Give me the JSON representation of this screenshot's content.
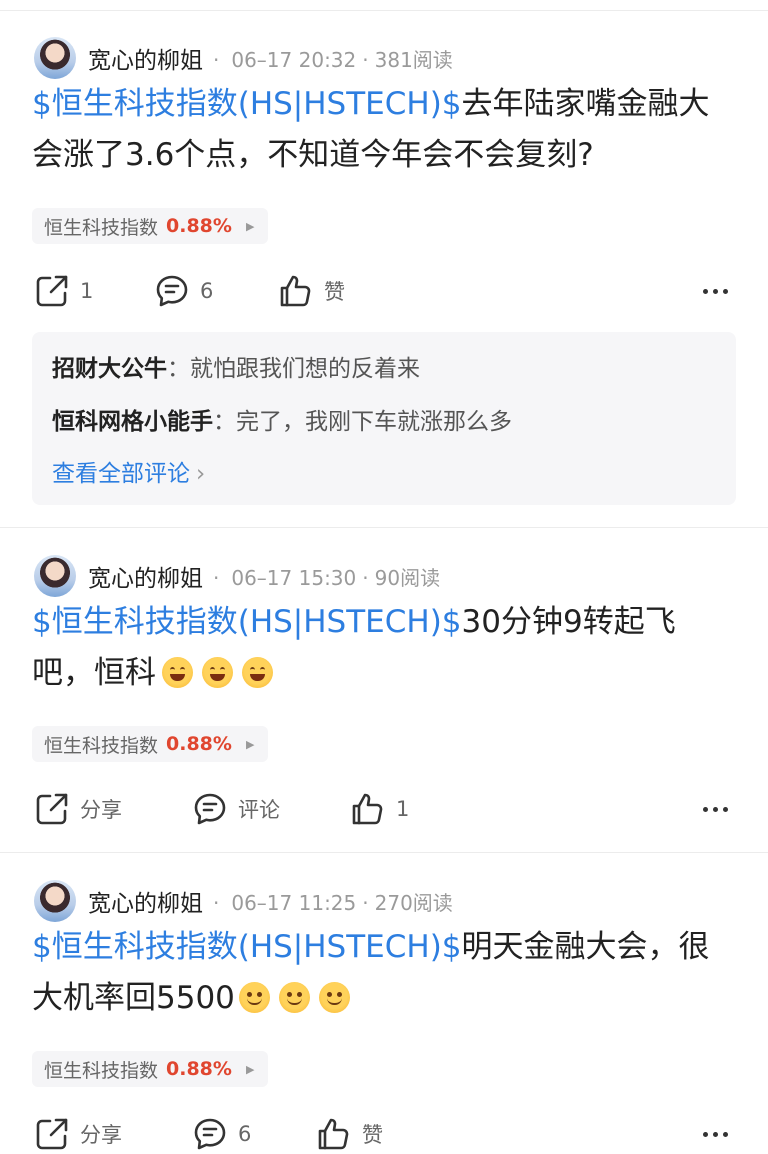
{
  "posts": [
    {
      "author": "宽心的柳姐",
      "time": "06–17 20:32",
      "views": "381阅读",
      "cashtag": "$恒生科技指数(HS|HSTECH)$",
      "text": "去年陆家嘴金融大会涨了3.6个点，不知道今年会不会复刻?",
      "emojis": [],
      "tag": {
        "name": "恒生科技指数",
        "change": "0.88%"
      },
      "actions": {
        "share": "1",
        "comment": "6",
        "like": "赞"
      },
      "comments": [
        {
          "author": "招财大公牛",
          "sep": "：",
          "text": "就怕跟我们想的反着来"
        },
        {
          "author": "恒科网格小能手",
          "sep": "：",
          "text": "完了，我刚下车就涨那么多"
        }
      ],
      "view_all": "查看全部评论"
    },
    {
      "author": "宽心的柳姐",
      "time": "06–17 15:30",
      "views": "90阅读",
      "cashtag": "$恒生科技指数(HS|HSTECH)$",
      "text": "30分钟9转起飞吧，恒科",
      "emojis": [
        "grin",
        "grin",
        "grin"
      ],
      "tag": {
        "name": "恒生科技指数",
        "change": "0.88%"
      },
      "actions": {
        "share": "分享",
        "comment": "评论",
        "like": "1"
      }
    },
    {
      "author": "宽心的柳姐",
      "time": "06–17 11:25",
      "views": "270阅读",
      "cashtag": "$恒生科技指数(HS|HSTECH)$",
      "text": "明天金融大会，很大机率回5500",
      "emojis": [
        "smile",
        "smile",
        "smile"
      ],
      "tag": {
        "name": "恒生科技指数",
        "change": "0.88%"
      },
      "actions": {
        "share": "分享",
        "comment": "6",
        "like": "赞"
      }
    }
  ],
  "icons": {
    "share": "share-icon",
    "comment": "comment-icon",
    "like": "thumbs-up-icon",
    "more": "more-icon"
  },
  "colors": {
    "link": "#2d7ee0",
    "up": "#e0462f"
  }
}
